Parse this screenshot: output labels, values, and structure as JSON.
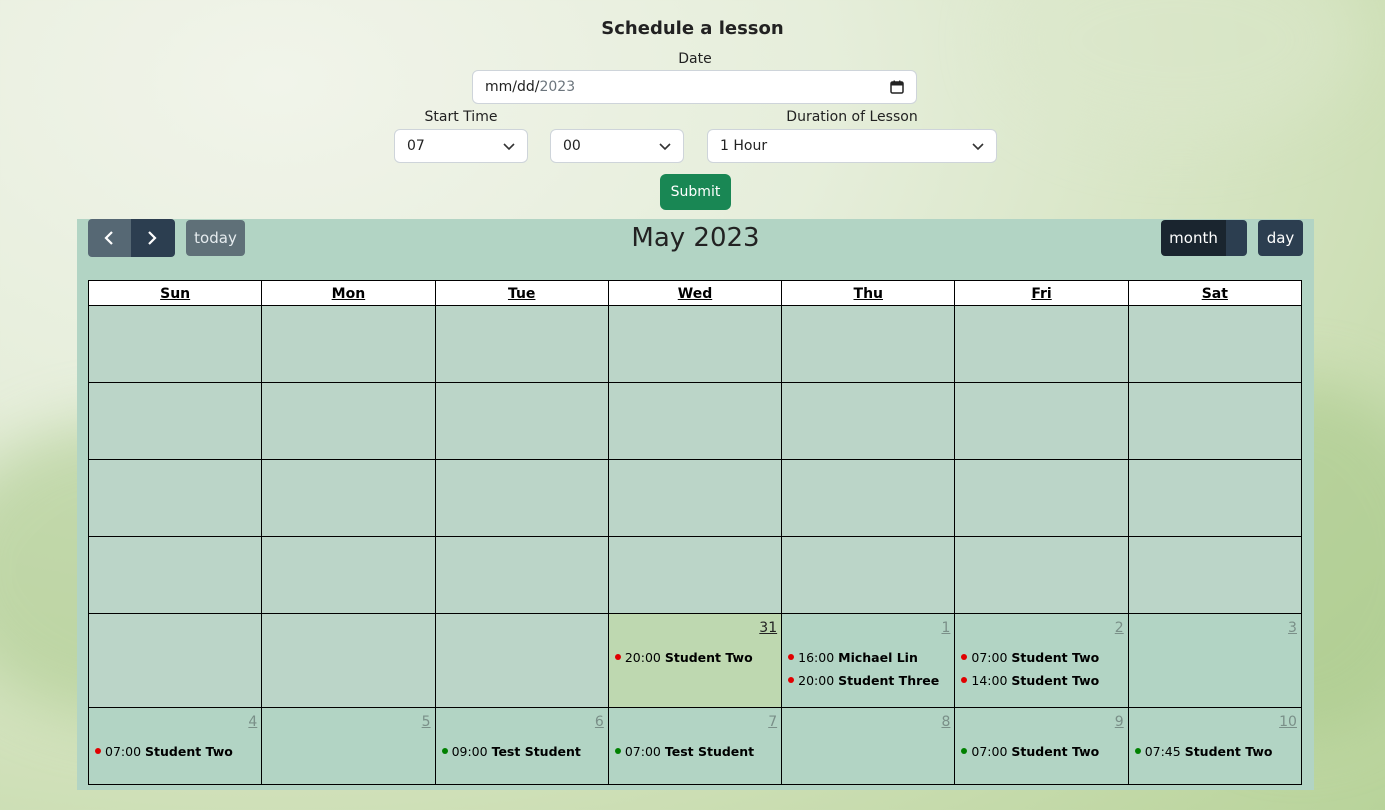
{
  "form": {
    "title": "Schedule a lesson",
    "date_label": "Date",
    "date_prefix": "mm/dd/",
    "date_year": "2023",
    "start_time_label": "Start Time",
    "hour_value": "07",
    "minute_value": "00",
    "duration_label": "Duration of Lesson",
    "duration_value": "1 Hour",
    "submit_label": "Submit"
  },
  "calendar": {
    "title": "May 2023",
    "today_label": "today",
    "month_label": "month",
    "day_label": "day",
    "weekdays": [
      "Sun",
      "Mon",
      "Tue",
      "Wed",
      "Thu",
      "Fri",
      "Sat"
    ],
    "week5": [
      "",
      "",
      "",
      "31",
      "1",
      "2",
      "3"
    ],
    "week6": [
      "4",
      "5",
      "6",
      "7",
      "8",
      "9",
      "10"
    ],
    "events": {
      "e1": {
        "time": "20:00",
        "name": "Student Two",
        "color": "#e00000"
      },
      "e2": {
        "time": "16:00",
        "name": "Michael Lin",
        "color": "#e00000"
      },
      "e3": {
        "time": "20:00",
        "name": "Student Three",
        "color": "#e00000"
      },
      "e4": {
        "time": "07:00",
        "name": "Student Two",
        "color": "#e00000"
      },
      "e5": {
        "time": "14:00",
        "name": "Student Two",
        "color": "#e00000"
      },
      "e6": {
        "time": "07:00",
        "name": "Student Two",
        "color": "#e00000"
      },
      "e7": {
        "time": "09:00",
        "name": "Test Student",
        "color": "#008000"
      },
      "e8": {
        "time": "07:00",
        "name": "Test Student",
        "color": "#008000"
      },
      "e9": {
        "time": "07:00",
        "name": "Student Two",
        "color": "#008000"
      },
      "e10": {
        "time": "07:45",
        "name": "Student Two",
        "color": "#008000"
      }
    }
  }
}
